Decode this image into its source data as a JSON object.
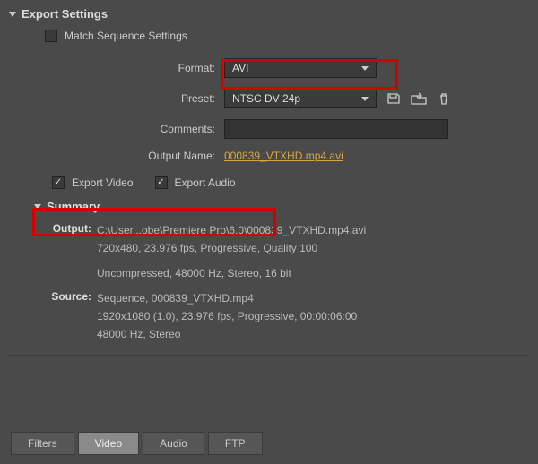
{
  "section_title": "Export Settings",
  "match_sequence": {
    "label": "Match Sequence Settings",
    "checked": false
  },
  "format": {
    "label": "Format:",
    "value": "AVI"
  },
  "preset": {
    "label": "Preset:",
    "value": "NTSC DV 24p"
  },
  "comments": {
    "label": "Comments:",
    "value": ""
  },
  "output_name": {
    "label": "Output Name:",
    "value": "000839_VTXHD.mp4.avi"
  },
  "export_video": {
    "label": "Export Video",
    "checked": true
  },
  "export_audio": {
    "label": "Export Audio",
    "checked": true
  },
  "summary": {
    "title": "Summary",
    "output": {
      "label": "Output:",
      "line1": "C:\\User...obe\\Premiere Pro\\6.0\\000839_VTXHD.mp4.avi",
      "line2": "720x480, 23.976 fps, Progressive, Quality 100",
      "line3": "Uncompressed, 48000 Hz, Stereo, 16 bit"
    },
    "source": {
      "label": "Source:",
      "line1": "Sequence, 000839_VTXHD.mp4",
      "line2": "1920x1080 (1.0), 23.976 fps, Progressive, 00:00:06:00",
      "line3": "48000 Hz, Stereo"
    }
  },
  "tabs": {
    "filters": "Filters",
    "video": "Video",
    "audio": "Audio",
    "ftp": "FTP",
    "active": "video"
  }
}
